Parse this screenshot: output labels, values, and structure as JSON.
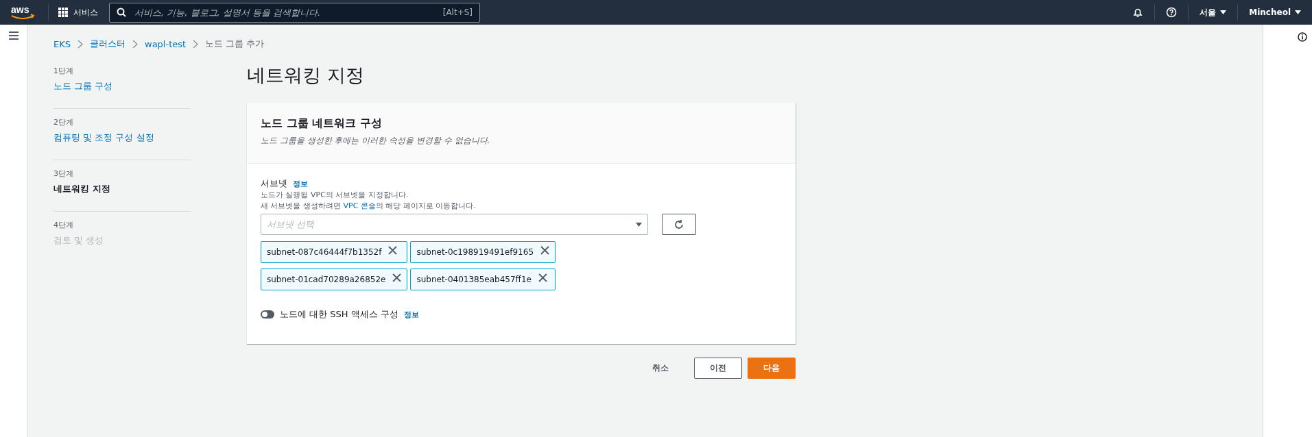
{
  "topbar": {
    "logo": "aws",
    "services": "서비스",
    "search": {
      "placeholder": "서비스, 기능, 블로그, 설명서 등을 검색합니다.",
      "shortcut": "[Alt+S]"
    },
    "region": "서울",
    "user": "Mincheol"
  },
  "breadcrumb": [
    {
      "label": "EKS",
      "link": true
    },
    {
      "label": "클러스터",
      "link": true
    },
    {
      "label": "wapl-test",
      "link": true
    },
    {
      "label": "노드 그룹 추가",
      "link": false
    }
  ],
  "steps": [
    {
      "step": "1단계",
      "label": "노드 그룹 구성",
      "selected": false,
      "disabled": false
    },
    {
      "step": "2단계",
      "label": "컴퓨팅 및 조정 구성 설정",
      "selected": false,
      "disabled": false
    },
    {
      "step": "3단계",
      "label": "네트워킹 지정",
      "selected": true,
      "disabled": false
    },
    {
      "step": "4단계",
      "label": "검토 및 생성",
      "selected": false,
      "disabled": true
    }
  ],
  "page_title": "네트워킹 지정",
  "card": {
    "title": "노드 그룹 네트워크 구성",
    "description": "노드 그룹을 생성한 후에는 이러한 속성을 변경할 수 없습니다.",
    "subnet": {
      "label": "서브넷",
      "info": "정보",
      "help_1": "노드가 실행될 VPC의 서브넷을 지정합니다.",
      "help_2_before": "새 서브넷을 생성하려면 ",
      "help_2_link": "VPC 콘솔",
      "help_2_after": "의 해당 페이지로 이동합니다.",
      "placeholder": "서브넷 선택",
      "tokens": [
        "subnet-087c46444f7b1352f",
        "subnet-0c198919491ef9165",
        "subnet-01cad70289a26852e",
        "subnet-0401385eab457ff1e"
      ]
    },
    "ssh": {
      "label": "노드에 대한 SSH 액세스 구성",
      "info": "정보",
      "on": false
    }
  },
  "actions": {
    "cancel": "취소",
    "previous": "이전",
    "next": "다음"
  }
}
